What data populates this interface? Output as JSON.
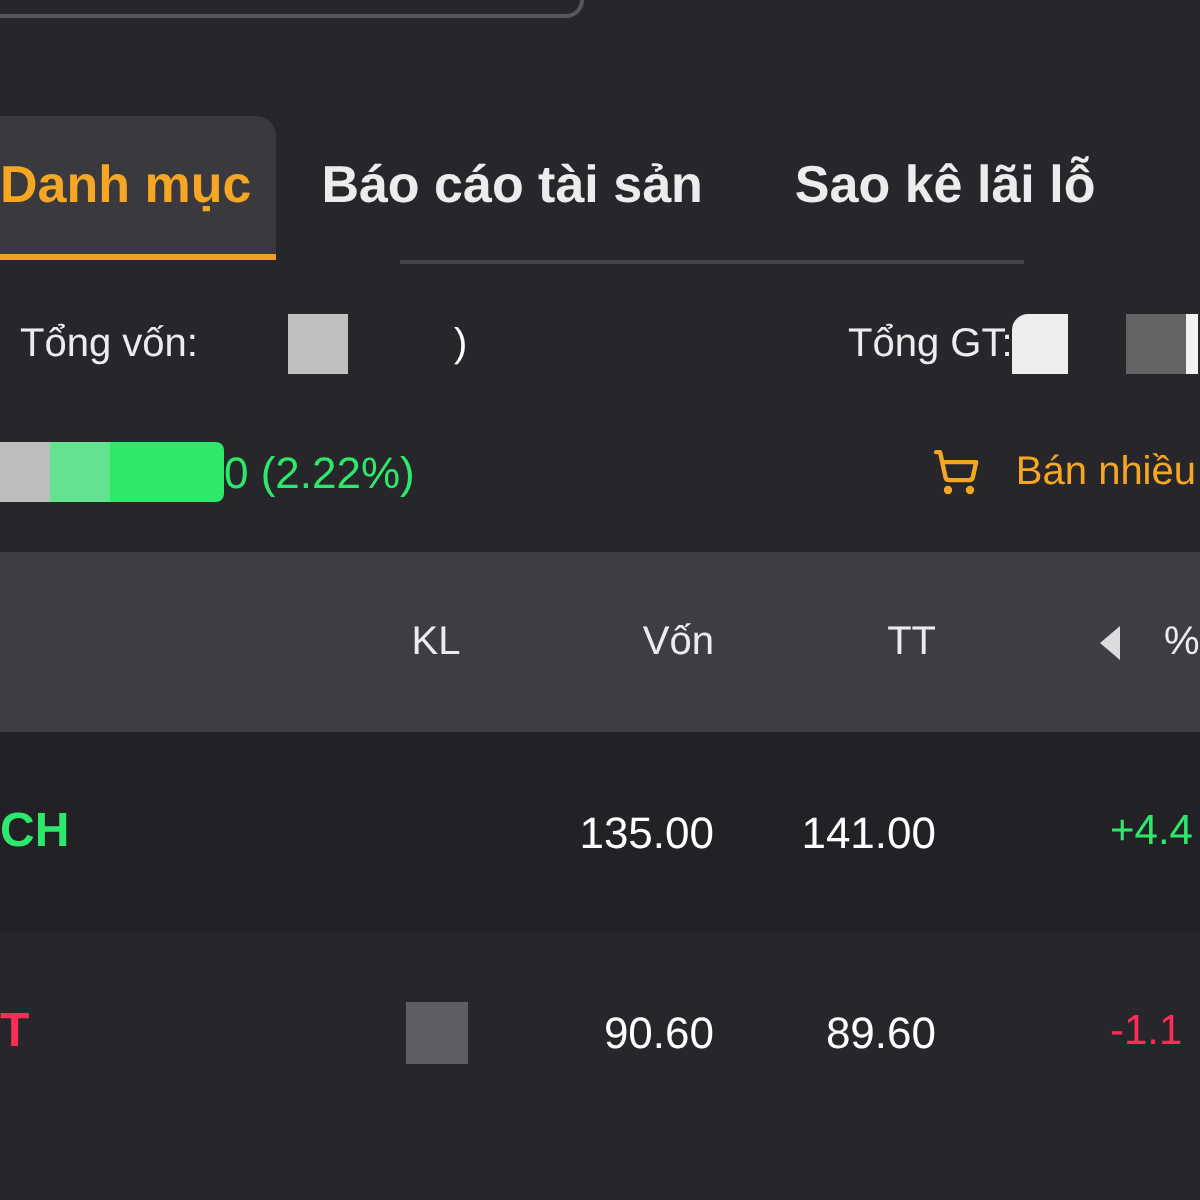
{
  "tabs": [
    {
      "label": "Danh mục",
      "selected": true
    },
    {
      "label": "Báo cáo tài sản",
      "selected": false
    },
    {
      "label": "Sao kê lãi lỗ",
      "selected": false
    }
  ],
  "summary": {
    "total_capital": {
      "label": "Tổng vốn:",
      "value_tail": ")"
    },
    "total_value": {
      "label": "Tổng GT:"
    }
  },
  "profit": {
    "value": "0 (2.22%)"
  },
  "sell_many_button": {
    "label": "Bán nhiều"
  },
  "table": {
    "columns": [
      {
        "label": "KL",
        "has_caret": false
      },
      {
        "label": "Vốn",
        "has_caret": false
      },
      {
        "label": "TT",
        "has_caret": false
      },
      {
        "label": "%",
        "has_caret": true
      }
    ],
    "rows": [
      {
        "symbol": "CH",
        "color": "#2ee86c",
        "volume_redacted": false,
        "cost": "135.00",
        "price": "141.00",
        "change": "+4.4"
      },
      {
        "symbol": "T",
        "color": "#ff2d55",
        "volume_redacted": true,
        "cost": "90.60",
        "price": "89.60",
        "change": "-1.1"
      }
    ]
  }
}
